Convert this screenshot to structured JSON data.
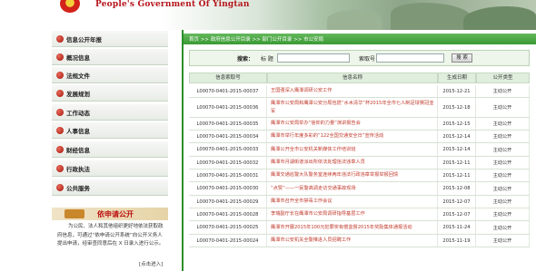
{
  "banner": {
    "title": "People's Government Of Yingtan"
  },
  "sidebar": {
    "items": [
      {
        "label": "信息公开年报"
      },
      {
        "label": "概况信息"
      },
      {
        "label": "法规文件"
      },
      {
        "label": "发展规划"
      },
      {
        "label": "工作动态"
      },
      {
        "label": "人事信息"
      },
      {
        "label": "财经信息"
      },
      {
        "label": "行政执法"
      },
      {
        "label": "公共服务"
      }
    ],
    "apply": {
      "title": "依申请公开",
      "text": "为公民、法人和其他组织更好地依法获取政府信息，可通过“依申请公开系统”向公开义务人提出申请，经审查同意后在 X 日录入进行公示。",
      "link": "[点击进入]"
    }
  },
  "breadcrumb": {
    "text": "首页 >> 政府信息公开目录 >> 部门公开目录 >> 市公安局"
  },
  "search": {
    "label": "搜索：",
    "title_label": "标  题",
    "index_label": "索取号",
    "button": "搜  索"
  },
  "table": {
    "headers": [
      "信息索取号",
      "信息名称",
      "生成日期",
      "公开类型"
    ],
    "rows": [
      {
        "id": "L00070-0401-2015-00037",
        "title": "王国强深入鹰潭调研公安工作",
        "date": "2015-12-21",
        "mode": "主动公开"
      },
      {
        "id": "L00070-0401-2015-00036",
        "title": "鹰潭市公安局和鹰潭公安分局包揽“水木清华”杯2015年全市七人制足球赛冠亚军",
        "date": "2015-12-18",
        "mode": "主动公开"
      },
      {
        "id": "L00070-0401-2015-00035",
        "title": "鹰潭市公安局举办“信仰的力量”演讲报告会",
        "date": "2015-12-15",
        "mode": "主动公开"
      },
      {
        "id": "L00070-0401-2015-00034",
        "title": "鹰潭市举行年度多彩的“122全国交通安全日”宣传活动",
        "date": "2015-12-14",
        "mode": "主动公开"
      },
      {
        "id": "L00070-0401-2015-00033",
        "title": "鹰潭公开全市公安机关新媒体工作培训班",
        "date": "2015-12-14",
        "mode": "主动公开"
      },
      {
        "id": "L00070-0401-2015-00032",
        "title": "鹰潭市月湖街道派出所依法处理违法违章人员",
        "date": "2015-12-11",
        "mode": "主动公开"
      },
      {
        "id": "L00070-0401-2015-00031",
        "title": "鹰潭交通巡警大队警务室连续两年违法行政违章举报举报回馈",
        "date": "2015-12-11",
        "mode": "主动公开"
      },
      {
        "id": "L00070-0401-2015-00030",
        "title": "“点赞”——一民警高调走访交通事故现场",
        "date": "2015-12-08",
        "mode": "主动公开"
      },
      {
        "id": "L00070-0401-2015-00029",
        "title": "鹰潭市召开全市禁毒工作会议",
        "date": "2015-12-07",
        "mode": "主动公开"
      },
      {
        "id": "L00070-0401-2015-00028",
        "title": "李瑞副厅长在鹰潭市公安局调研指导基层工作",
        "date": "2015-12-07",
        "mode": "主动公开"
      },
      {
        "id": "L00070-0401-2015-00025",
        "title": "鹰潭市开展2015年100元犯罪奖有偿监督2015年奖励集体通报活动",
        "date": "2015-11-24",
        "mode": "主动公开"
      },
      {
        "id": "L00070-0401-2015-00024",
        "title": "鹰潭市公安机关全警推进人员招聘工作",
        "date": "2015-11-19",
        "mode": "主动公开"
      }
    ]
  }
}
